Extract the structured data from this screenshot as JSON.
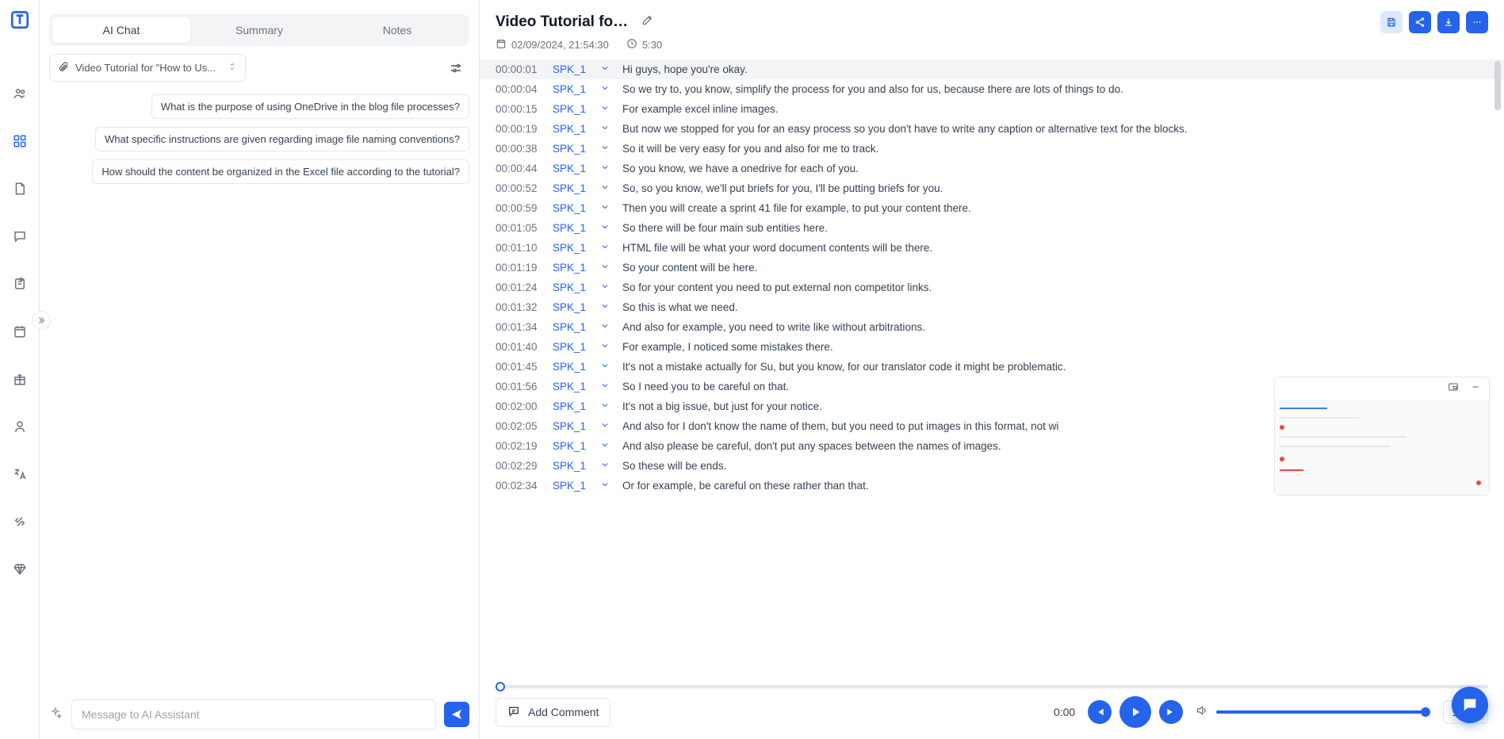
{
  "tabs": {
    "ai_chat": "AI Chat",
    "summary": "Summary",
    "notes": "Notes"
  },
  "file_select": "Video Tutorial for \"How to Us...",
  "suggestions": [
    "What is the purpose of using OneDrive in the blog file processes?",
    "What specific instructions are given regarding image file naming conventions?",
    "How should the content be organized in the Excel file according to the tutorial?"
  ],
  "msg_placeholder": "Message to AI Assistant",
  "header": {
    "title": "Video Tutorial for \"Ho...",
    "date": "02/09/2024, 21:54:30",
    "duration": "5:30"
  },
  "transcript": [
    {
      "t": "00:00:01",
      "s": "SPK_1",
      "text": "Hi guys, hope you're okay.",
      "hl": true
    },
    {
      "t": "00:00:04",
      "s": "SPK_1",
      "text": "So we try to, you know, simplify the process for you and also for us, because there are lots of things to do."
    },
    {
      "t": "00:00:15",
      "s": "SPK_1",
      "text": "For example excel inline images."
    },
    {
      "t": "00:00:19",
      "s": "SPK_1",
      "text": "But now we stopped for you for an easy process so you don't have to write any caption or alternative text for the blocks."
    },
    {
      "t": "00:00:38",
      "s": "SPK_1",
      "text": "So it will be very easy for you and also for me to track."
    },
    {
      "t": "00:00:44",
      "s": "SPK_1",
      "text": "So you know, we have a onedrive for each of you."
    },
    {
      "t": "00:00:52",
      "s": "SPK_1",
      "text": "So, so you know, we'll put briefs for you, I'll be putting briefs for you."
    },
    {
      "t": "00:00:59",
      "s": "SPK_1",
      "text": "Then you will create a sprint 41 file for example, to put your content there."
    },
    {
      "t": "00:01:05",
      "s": "SPK_1",
      "text": "So there will be four main sub entities here."
    },
    {
      "t": "00:01:10",
      "s": "SPK_1",
      "text": "HTML file will be what your word document contents will be there."
    },
    {
      "t": "00:01:19",
      "s": "SPK_1",
      "text": "So your content will be here."
    },
    {
      "t": "00:01:24",
      "s": "SPK_1",
      "text": "So for your content you need to put external non competitor links."
    },
    {
      "t": "00:01:32",
      "s": "SPK_1",
      "text": "So this is what we need."
    },
    {
      "t": "00:01:34",
      "s": "SPK_1",
      "text": "And also for example, you need to write like without arbitrations."
    },
    {
      "t": "00:01:40",
      "s": "SPK_1",
      "text": "For example, I noticed some mistakes there."
    },
    {
      "t": "00:01:45",
      "s": "SPK_1",
      "text": "It's not a mistake actually for Su, but you know, for our translator code it might be problematic."
    },
    {
      "t": "00:01:56",
      "s": "SPK_1",
      "text": "So I need you to be careful on that."
    },
    {
      "t": "00:02:00",
      "s": "SPK_1",
      "text": "It's not a big issue, but just for your notice."
    },
    {
      "t": "00:02:05",
      "s": "SPK_1",
      "text": "And also for I don't know the name of them, but you need to put images in this format, not wi"
    },
    {
      "t": "00:02:19",
      "s": "SPK_1",
      "text": "And also please be careful, don't put any spaces between the names of images."
    },
    {
      "t": "00:02:29",
      "s": "SPK_1",
      "text": "So these will be ends."
    },
    {
      "t": "00:02:34",
      "s": "SPK_1",
      "text": "Or for example, be careful on these rather than that."
    }
  ],
  "controls": {
    "add_comment": "Add Comment",
    "current_time": "0:00",
    "speed": "1x"
  }
}
